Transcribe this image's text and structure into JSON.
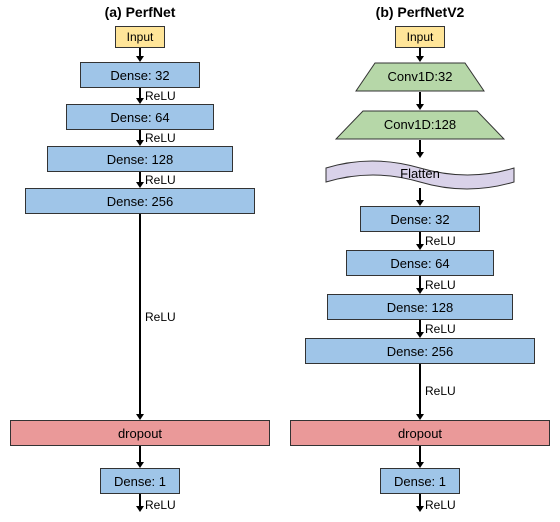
{
  "title_a": "(a) PerfNet",
  "title_b": "(b) PerfNetV2",
  "input_label": "Input",
  "dense32": "Dense: 32",
  "dense64": "Dense: 64",
  "dense128": "Dense: 128",
  "dense256": "Dense: 256",
  "dense1": "Dense: 1",
  "conv32": "Conv1D:32",
  "conv128": "Conv1D:128",
  "flatten": "Flatten",
  "dropout": "dropout",
  "relu": "ReLU",
  "colors": {
    "input": "#ffe599",
    "dense": "#9fc5e8",
    "dropout": "#ea9999",
    "conv": "#b6d7a8",
    "flatten": "#d9d2e9"
  },
  "chart_data": [
    {
      "type": "diagram",
      "name": "PerfNet",
      "layers": [
        {
          "layer": "Input"
        },
        {
          "layer": "Dense",
          "units": 32,
          "activation": "ReLU"
        },
        {
          "layer": "Dense",
          "units": 64,
          "activation": "ReLU"
        },
        {
          "layer": "Dense",
          "units": 128,
          "activation": "ReLU"
        },
        {
          "layer": "Dense",
          "units": 256,
          "activation": "ReLU"
        },
        {
          "layer": "Dropout"
        },
        {
          "layer": "Dense",
          "units": 1,
          "activation": "ReLU"
        }
      ]
    },
    {
      "type": "diagram",
      "name": "PerfNetV2",
      "layers": [
        {
          "layer": "Input"
        },
        {
          "layer": "Conv1D",
          "filters": 32
        },
        {
          "layer": "Conv1D",
          "filters": 128
        },
        {
          "layer": "Flatten"
        },
        {
          "layer": "Dense",
          "units": 32,
          "activation": "ReLU"
        },
        {
          "layer": "Dense",
          "units": 64,
          "activation": "ReLU"
        },
        {
          "layer": "Dense",
          "units": 128,
          "activation": "ReLU"
        },
        {
          "layer": "Dense",
          "units": 256,
          "activation": "ReLU"
        },
        {
          "layer": "Dropout"
        },
        {
          "layer": "Dense",
          "units": 1,
          "activation": "ReLU"
        }
      ]
    }
  ]
}
